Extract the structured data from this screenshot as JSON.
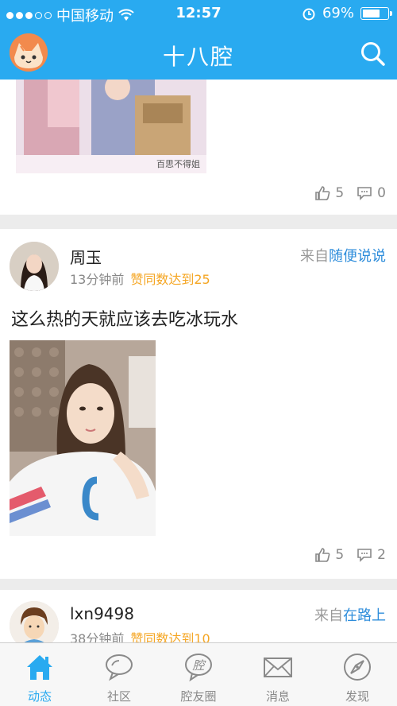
{
  "status_bar": {
    "carrier": "中国移动",
    "time": "12:57",
    "battery": "69%",
    "battery_level": 0.69
  },
  "header": {
    "title": "十八腔"
  },
  "posts": [
    {
      "image_watermark": "百思不得姐",
      "likes": "5",
      "comments": "0"
    },
    {
      "username": "周玉",
      "time_ago": "13分钟前",
      "highlight": "赞同数达到25",
      "from_prefix": "来自",
      "source": "随便说说",
      "text": "这么热的天就应该去吃冰玩水",
      "likes": "5",
      "comments": "2"
    },
    {
      "username": "lxn9498",
      "time_ago": "38分钟前",
      "highlight": "赞同数达到10",
      "from_prefix": "来自",
      "source": "在路上"
    }
  ],
  "tabs": [
    {
      "label": "动态",
      "icon": "home-icon",
      "active": true
    },
    {
      "label": "社区",
      "icon": "chat-bubble-icon",
      "active": false
    },
    {
      "label": "腔友圈",
      "icon": "qiang-circle-icon",
      "active": false
    },
    {
      "label": "消息",
      "icon": "envelope-icon",
      "active": false
    },
    {
      "label": "发现",
      "icon": "compass-icon",
      "active": false
    }
  ],
  "colors": {
    "brand": "#29aaf0",
    "highlight": "#f5a623",
    "source_link": "#2e8ddb"
  }
}
